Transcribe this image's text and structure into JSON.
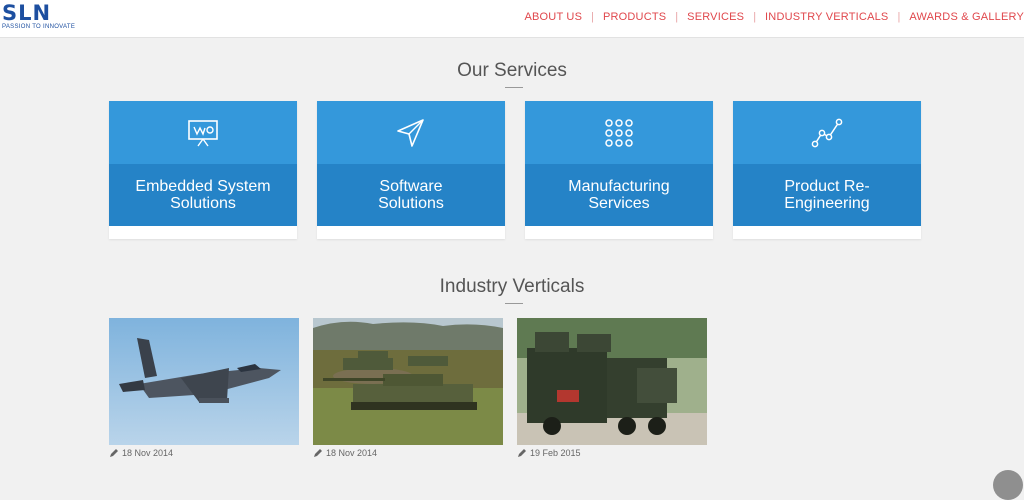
{
  "header": {
    "logo_text": "SLN",
    "logo_tagline": "PASSION TO INNOVATE",
    "nav": [
      "ABOUT US",
      "PRODUCTS",
      "SERVICES",
      "INDUSTRY VERTICALS",
      "AWARDS & GALLERY"
    ]
  },
  "services": {
    "title": "Our Services",
    "cards": [
      {
        "line1": "Embedded System",
        "line2": "Solutions",
        "icon": "presentation-board-icon"
      },
      {
        "line1": "Software",
        "line2": "Solutions",
        "icon": "paper-plane-icon"
      },
      {
        "line1": "Manufacturing",
        "line2": "Services",
        "icon": "dot-grid-icon"
      },
      {
        "line1": "Product Re-",
        "line2": "Engineering",
        "icon": "line-graph-icon"
      }
    ]
  },
  "industry": {
    "title": "Industry Verticals",
    "items": [
      {
        "date": "18 Nov 2014",
        "image": "fighter-jet-photo"
      },
      {
        "date": "18 Nov 2014",
        "image": "battle-tanks-photo"
      },
      {
        "date": "19 Feb 2015",
        "image": "military-trucks-photo"
      }
    ]
  },
  "colors": {
    "card_top": "#3498db",
    "card_bottom": "#2583c7",
    "nav_text": "#e0474c",
    "logo": "#1d4fa0"
  }
}
